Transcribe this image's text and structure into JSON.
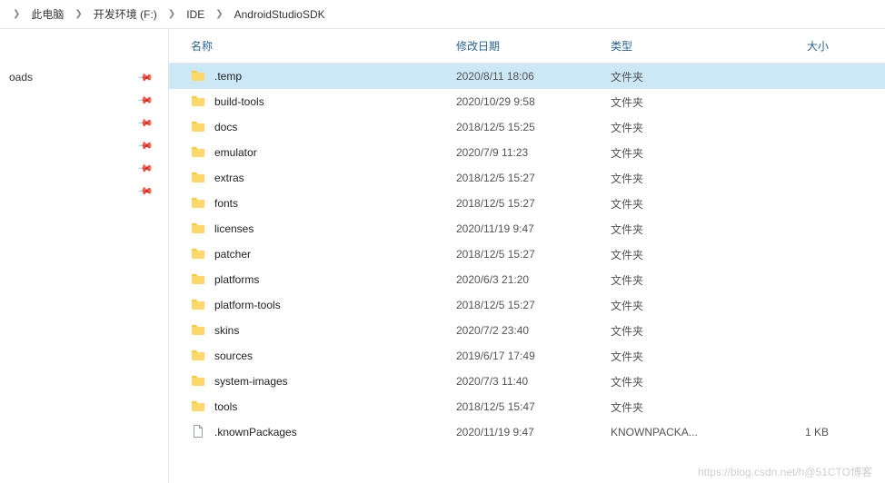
{
  "breadcrumb": {
    "items": [
      "此电脑",
      "开发环境 (F:)",
      "IDE",
      "AndroidStudioSDK"
    ]
  },
  "nav": {
    "quick_label": "oads"
  },
  "columns": {
    "name": "名称",
    "date": "修改日期",
    "type": "类型",
    "size": "大小"
  },
  "rows": [
    {
      "name": ".temp",
      "date": "2020/8/11 18:06",
      "type": "文件夹",
      "size": "",
      "kind": "folder",
      "selected": true
    },
    {
      "name": "build-tools",
      "date": "2020/10/29 9:58",
      "type": "文件夹",
      "size": "",
      "kind": "folder"
    },
    {
      "name": "docs",
      "date": "2018/12/5 15:25",
      "type": "文件夹",
      "size": "",
      "kind": "folder"
    },
    {
      "name": "emulator",
      "date": "2020/7/9 11:23",
      "type": "文件夹",
      "size": "",
      "kind": "folder"
    },
    {
      "name": "extras",
      "date": "2018/12/5 15:27",
      "type": "文件夹",
      "size": "",
      "kind": "folder"
    },
    {
      "name": "fonts",
      "date": "2018/12/5 15:27",
      "type": "文件夹",
      "size": "",
      "kind": "folder"
    },
    {
      "name": "licenses",
      "date": "2020/11/19 9:47",
      "type": "文件夹",
      "size": "",
      "kind": "folder"
    },
    {
      "name": "patcher",
      "date": "2018/12/5 15:27",
      "type": "文件夹",
      "size": "",
      "kind": "folder"
    },
    {
      "name": "platforms",
      "date": "2020/6/3 21:20",
      "type": "文件夹",
      "size": "",
      "kind": "folder"
    },
    {
      "name": "platform-tools",
      "date": "2018/12/5 15:27",
      "type": "文件夹",
      "size": "",
      "kind": "folder"
    },
    {
      "name": "skins",
      "date": "2020/7/2 23:40",
      "type": "文件夹",
      "size": "",
      "kind": "folder"
    },
    {
      "name": "sources",
      "date": "2019/6/17 17:49",
      "type": "文件夹",
      "size": "",
      "kind": "folder"
    },
    {
      "name": "system-images",
      "date": "2020/7/3 11:40",
      "type": "文件夹",
      "size": "",
      "kind": "folder"
    },
    {
      "name": "tools",
      "date": "2018/12/5 15:47",
      "type": "文件夹",
      "size": "",
      "kind": "folder"
    },
    {
      "name": ".knownPackages",
      "date": "2020/11/19 9:47",
      "type": "KNOWNPACKA...",
      "size": "1 KB",
      "kind": "file"
    }
  ],
  "watermark": "https://blog.csdn.net/h@51CTO博客"
}
